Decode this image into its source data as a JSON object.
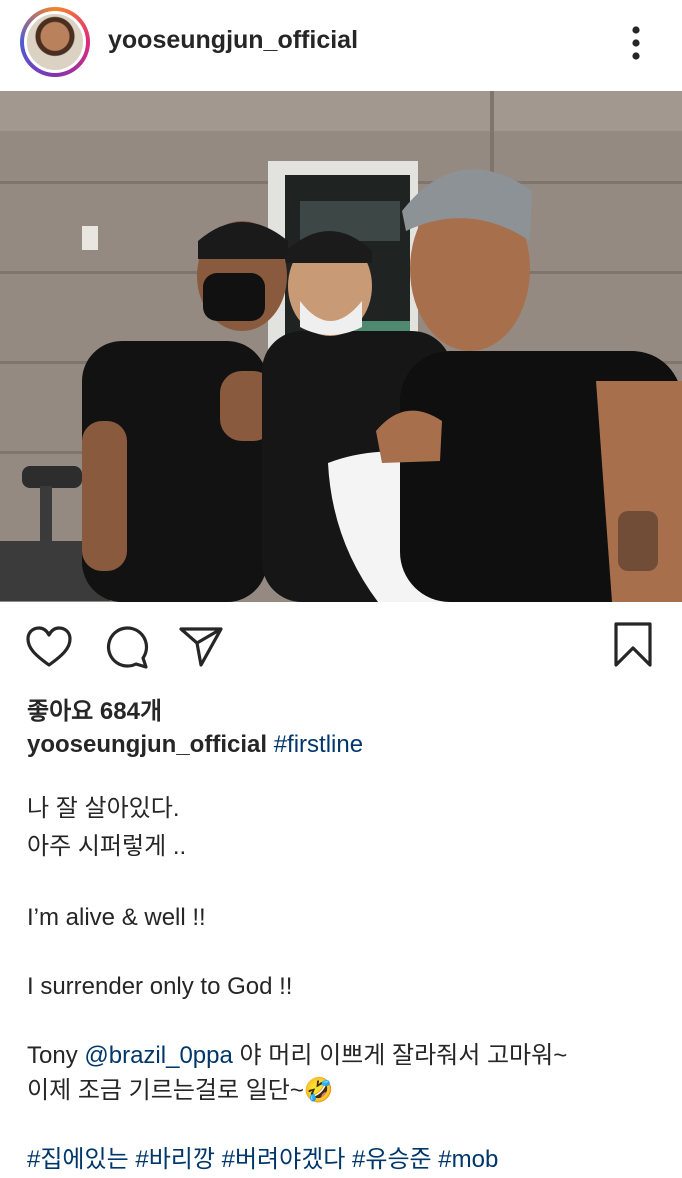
{
  "post": {
    "username": "yooseungjun_official",
    "likes": "좋아요 684개",
    "caption_user": "yooseungjun_official",
    "caption_tag": "#firstline",
    "lines": {
      "l1": "나 잘 살아있다.",
      "l2": "아주 시퍼렇게 ..",
      "l3": "I’m alive & well !!",
      "l4": "I surrender only to God !!",
      "l5_pre": "Tony",
      "l5_mention": "@brazil_0ppa",
      "l5_post": "야 머리 이쁘게 잘라줘서 고마워~",
      "l6": "이제 조금 기르는걸로 일단~",
      "l6_emoji": "🤣"
    },
    "hashtags": [
      "#집에있는",
      "#바리깡",
      "#버려야겠다",
      "#유승준",
      "#mob"
    ]
  },
  "icons": {
    "more": "more-vertical-icon",
    "like": "heart-icon",
    "comment": "comment-icon",
    "share": "send-icon",
    "save": "bookmark-icon"
  },
  "colors": {
    "link": "#00376b",
    "text": "#262626"
  }
}
